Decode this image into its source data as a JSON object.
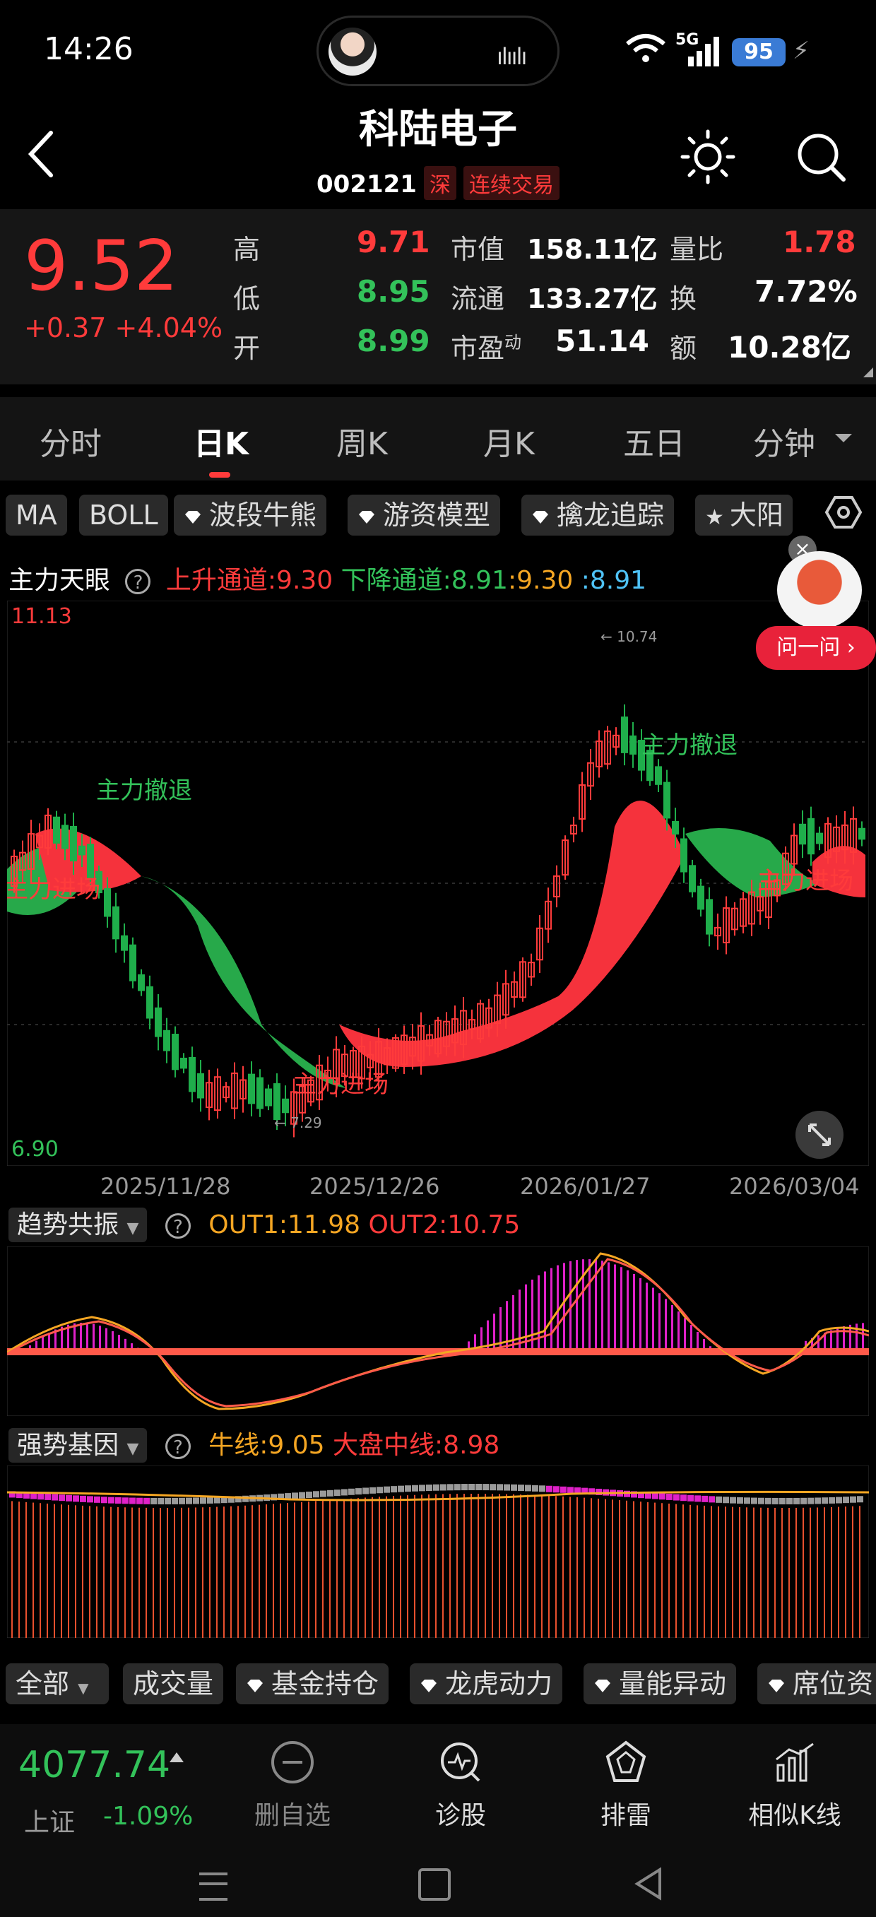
{
  "status": {
    "time": "14:26",
    "network": "5G",
    "battery": "95"
  },
  "header": {
    "title": "科陆电子",
    "code": "002121",
    "exchange_tag": "深",
    "trading_tag": "连续交易"
  },
  "quote": {
    "price": "9.52",
    "change": "+0.37 +4.04%",
    "high_label": "高",
    "high": "9.71",
    "low_label": "低",
    "low": "8.95",
    "open_label": "开",
    "open": "8.99",
    "mktcap_label": "市值",
    "mktcap": "158.11亿",
    "float_label": "流通",
    "float": "133.27亿",
    "pe_label": "市盈",
    "pe_sup": "动",
    "pe": "51.14",
    "volratio_label": "量比",
    "volratio": "1.78",
    "turnover_label": "换",
    "turnover": "7.72%",
    "amount_label": "额",
    "amount": "10.28亿"
  },
  "period_tabs": [
    "分时",
    "日K",
    "周K",
    "月K",
    "五日",
    "分钟"
  ],
  "indicator_chips": [
    "MA",
    "BOLL",
    "波段牛熊",
    "游资模型",
    "擒龙追踪",
    "大阳"
  ],
  "legend": {
    "name": "主力天眼",
    "up_channel": "上升通道:9.30",
    "down_channel": "下降通道:8.91",
    "v1": ":9.30",
    "v2": ":8.91"
  },
  "chart": {
    "y_max_label": "11.13",
    "y_min_label": "6.90",
    "high_marker": "← 10.74",
    "low_marker": "← 7.29",
    "annotations": {
      "exit1": "主力撤退",
      "exit2": "主力撤退",
      "enter1": "主力进场",
      "enter2": "主力进场",
      "enter3": "主力进场"
    },
    "dates": [
      "2025/11/28",
      "2025/12/26",
      "2026/01/27",
      "2026/03/04"
    ],
    "colors": {
      "up": "#ff3b3b",
      "down": "#1fae4b",
      "band_red": "#f5323c",
      "band_green": "#27a94a"
    }
  },
  "ask_widget": {
    "label": "问一问 ›"
  },
  "trend_panel": {
    "name": "趋势共振",
    "out1": "OUT1:11.98",
    "out2": "OUT2:10.75"
  },
  "strength_panel": {
    "name": "强势基因",
    "bull": "牛线:9.05",
    "market": "大盘中线:8.98"
  },
  "bottom_chips": [
    "全部",
    "成交量",
    "基金持仓",
    "龙虎动力",
    "量能异动",
    "席位资"
  ],
  "index": {
    "value": "4077.74",
    "name": "上证",
    "change": "-1.09%"
  },
  "bottom_nav": [
    "删自选",
    "诊股",
    "排雷",
    "相似K线"
  ]
}
